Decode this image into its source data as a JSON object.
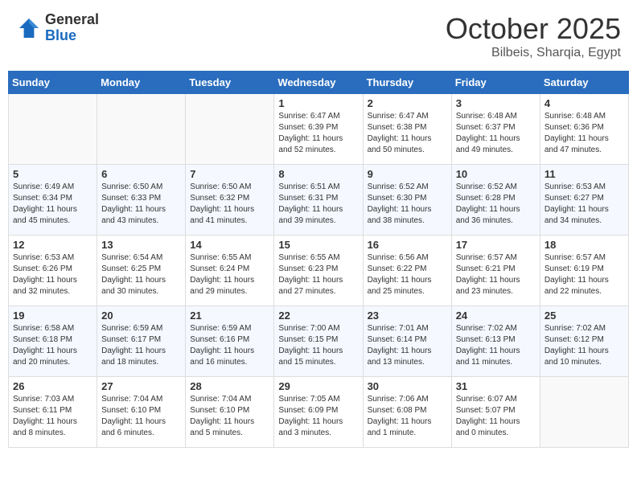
{
  "header": {
    "logo_general": "General",
    "logo_blue": "Blue",
    "month": "October 2025",
    "location": "Bilbeis, Sharqia, Egypt"
  },
  "days_of_week": [
    "Sunday",
    "Monday",
    "Tuesday",
    "Wednesday",
    "Thursday",
    "Friday",
    "Saturday"
  ],
  "weeks": [
    [
      {
        "day": "",
        "info": ""
      },
      {
        "day": "",
        "info": ""
      },
      {
        "day": "",
        "info": ""
      },
      {
        "day": "1",
        "info": "Sunrise: 6:47 AM\nSunset: 6:39 PM\nDaylight: 11 hours\nand 52 minutes."
      },
      {
        "day": "2",
        "info": "Sunrise: 6:47 AM\nSunset: 6:38 PM\nDaylight: 11 hours\nand 50 minutes."
      },
      {
        "day": "3",
        "info": "Sunrise: 6:48 AM\nSunset: 6:37 PM\nDaylight: 11 hours\nand 49 minutes."
      },
      {
        "day": "4",
        "info": "Sunrise: 6:48 AM\nSunset: 6:36 PM\nDaylight: 11 hours\nand 47 minutes."
      }
    ],
    [
      {
        "day": "5",
        "info": "Sunrise: 6:49 AM\nSunset: 6:34 PM\nDaylight: 11 hours\nand 45 minutes."
      },
      {
        "day": "6",
        "info": "Sunrise: 6:50 AM\nSunset: 6:33 PM\nDaylight: 11 hours\nand 43 minutes."
      },
      {
        "day": "7",
        "info": "Sunrise: 6:50 AM\nSunset: 6:32 PM\nDaylight: 11 hours\nand 41 minutes."
      },
      {
        "day": "8",
        "info": "Sunrise: 6:51 AM\nSunset: 6:31 PM\nDaylight: 11 hours\nand 39 minutes."
      },
      {
        "day": "9",
        "info": "Sunrise: 6:52 AM\nSunset: 6:30 PM\nDaylight: 11 hours\nand 38 minutes."
      },
      {
        "day": "10",
        "info": "Sunrise: 6:52 AM\nSunset: 6:28 PM\nDaylight: 11 hours\nand 36 minutes."
      },
      {
        "day": "11",
        "info": "Sunrise: 6:53 AM\nSunset: 6:27 PM\nDaylight: 11 hours\nand 34 minutes."
      }
    ],
    [
      {
        "day": "12",
        "info": "Sunrise: 6:53 AM\nSunset: 6:26 PM\nDaylight: 11 hours\nand 32 minutes."
      },
      {
        "day": "13",
        "info": "Sunrise: 6:54 AM\nSunset: 6:25 PM\nDaylight: 11 hours\nand 30 minutes."
      },
      {
        "day": "14",
        "info": "Sunrise: 6:55 AM\nSunset: 6:24 PM\nDaylight: 11 hours\nand 29 minutes."
      },
      {
        "day": "15",
        "info": "Sunrise: 6:55 AM\nSunset: 6:23 PM\nDaylight: 11 hours\nand 27 minutes."
      },
      {
        "day": "16",
        "info": "Sunrise: 6:56 AM\nSunset: 6:22 PM\nDaylight: 11 hours\nand 25 minutes."
      },
      {
        "day": "17",
        "info": "Sunrise: 6:57 AM\nSunset: 6:21 PM\nDaylight: 11 hours\nand 23 minutes."
      },
      {
        "day": "18",
        "info": "Sunrise: 6:57 AM\nSunset: 6:19 PM\nDaylight: 11 hours\nand 22 minutes."
      }
    ],
    [
      {
        "day": "19",
        "info": "Sunrise: 6:58 AM\nSunset: 6:18 PM\nDaylight: 11 hours\nand 20 minutes."
      },
      {
        "day": "20",
        "info": "Sunrise: 6:59 AM\nSunset: 6:17 PM\nDaylight: 11 hours\nand 18 minutes."
      },
      {
        "day": "21",
        "info": "Sunrise: 6:59 AM\nSunset: 6:16 PM\nDaylight: 11 hours\nand 16 minutes."
      },
      {
        "day": "22",
        "info": "Sunrise: 7:00 AM\nSunset: 6:15 PM\nDaylight: 11 hours\nand 15 minutes."
      },
      {
        "day": "23",
        "info": "Sunrise: 7:01 AM\nSunset: 6:14 PM\nDaylight: 11 hours\nand 13 minutes."
      },
      {
        "day": "24",
        "info": "Sunrise: 7:02 AM\nSunset: 6:13 PM\nDaylight: 11 hours\nand 11 minutes."
      },
      {
        "day": "25",
        "info": "Sunrise: 7:02 AM\nSunset: 6:12 PM\nDaylight: 11 hours\nand 10 minutes."
      }
    ],
    [
      {
        "day": "26",
        "info": "Sunrise: 7:03 AM\nSunset: 6:11 PM\nDaylight: 11 hours\nand 8 minutes."
      },
      {
        "day": "27",
        "info": "Sunrise: 7:04 AM\nSunset: 6:10 PM\nDaylight: 11 hours\nand 6 minutes."
      },
      {
        "day": "28",
        "info": "Sunrise: 7:04 AM\nSunset: 6:10 PM\nDaylight: 11 hours\nand 5 minutes."
      },
      {
        "day": "29",
        "info": "Sunrise: 7:05 AM\nSunset: 6:09 PM\nDaylight: 11 hours\nand 3 minutes."
      },
      {
        "day": "30",
        "info": "Sunrise: 7:06 AM\nSunset: 6:08 PM\nDaylight: 11 hours\nand 1 minute."
      },
      {
        "day": "31",
        "info": "Sunrise: 6:07 AM\nSunset: 5:07 PM\nDaylight: 11 hours\nand 0 minutes."
      },
      {
        "day": "",
        "info": ""
      }
    ]
  ]
}
